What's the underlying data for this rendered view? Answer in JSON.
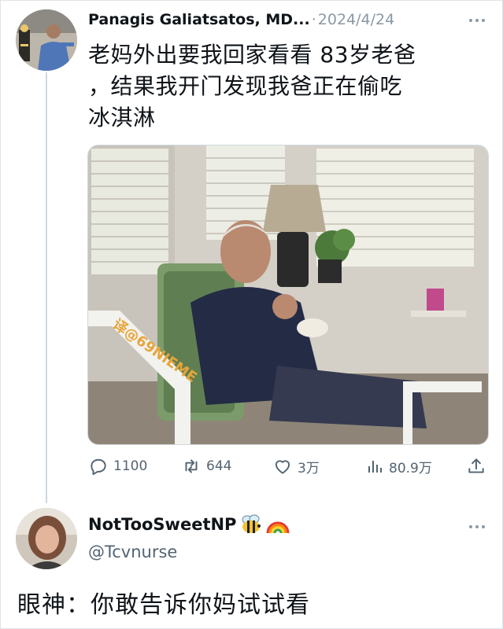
{
  "tweet1": {
    "author_name": "Panagis Galiatsatos, MD...",
    "separator": "·",
    "date": "2024/4/24",
    "text": "老妈外出要我回家看看 83岁老爸\n，结果我开门发现我爸正在偷吃\n冰淇淋",
    "image_watermark": "译@69NIEME",
    "actions": {
      "reply_count": "1100",
      "retweet_count": "644",
      "like_count": "3万",
      "view_count": "80.9万"
    }
  },
  "tweet2": {
    "author_name": "NotTooSweetNP",
    "name_emojis": [
      "bee-icon",
      "rainbow-icon"
    ],
    "handle": "@Tcvnurse",
    "text": "眼神：你敢告诉你妈试试看"
  },
  "colors": {
    "text_primary": "#0f1419",
    "text_secondary": "#536471",
    "date_gray": "#8b98a5",
    "thread_line": "#cfd9de",
    "background": "#ffffff"
  }
}
